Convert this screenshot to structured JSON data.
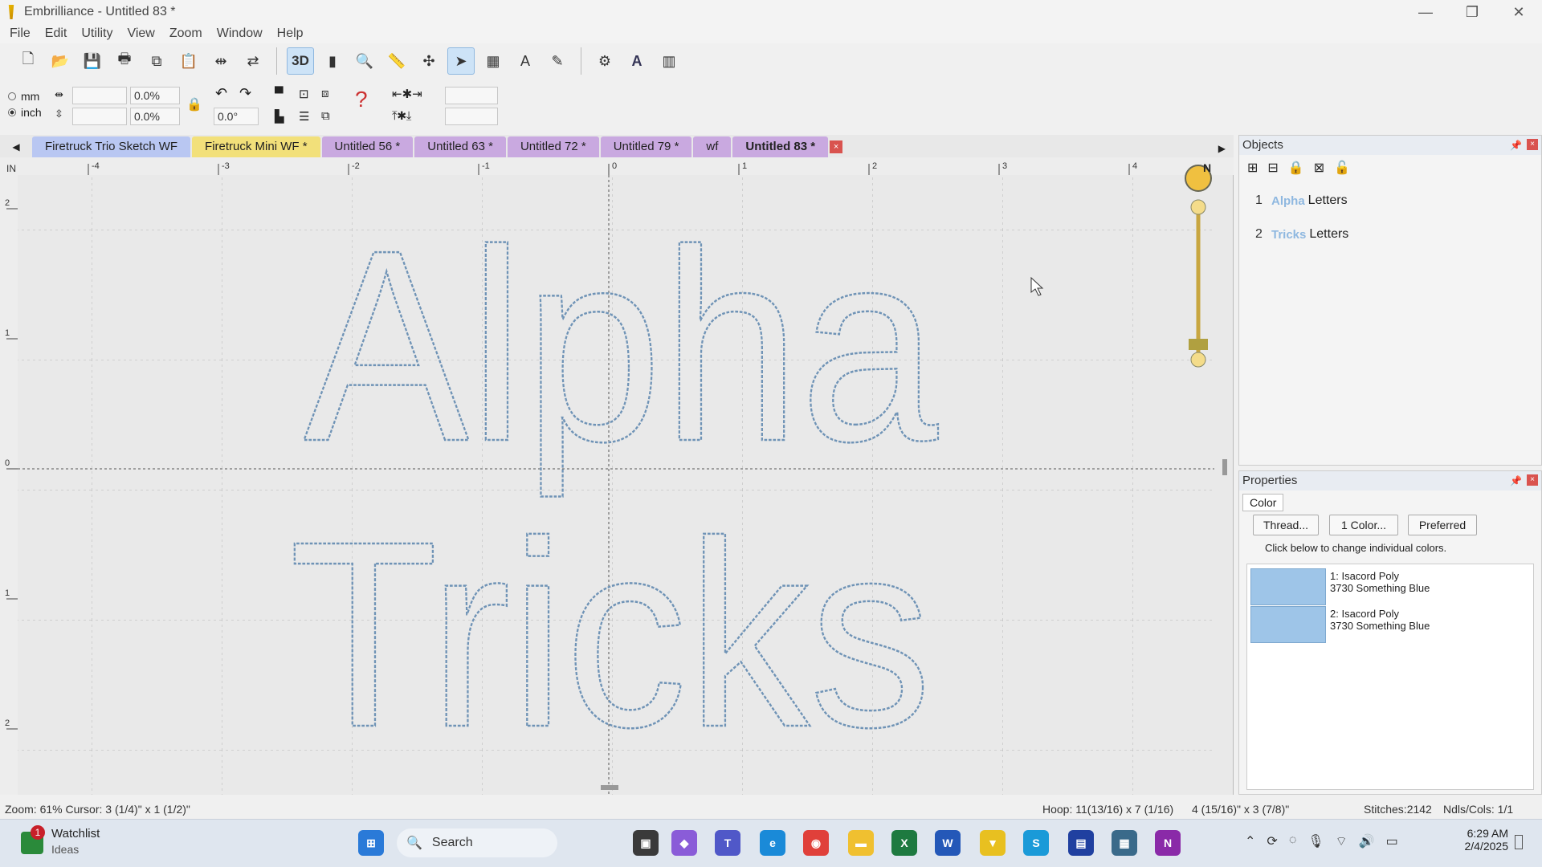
{
  "window": {
    "title": "Embrilliance - Untitled 83 *",
    "minimize": "—",
    "maximize": "❐",
    "close": "✕"
  },
  "menu": [
    "File",
    "Edit",
    "Utility",
    "View",
    "Zoom",
    "Window",
    "Help"
  ],
  "toolbar2": {
    "unit_mm": "mm",
    "unit_inch": "inch",
    "width_value": "",
    "height_value": "",
    "width_pct": "0.0%",
    "height_pct": "0.0%",
    "rotation": "0.0°"
  },
  "tabs": [
    {
      "label": "Firetruck Trio Sketch WF",
      "color": "#b9c7f2"
    },
    {
      "label": "Firetruck Mini WF *",
      "color": "#f2e07a"
    },
    {
      "label": "Untitled 56 *",
      "color": "#c9a9e0"
    },
    {
      "label": "Untitled 63 *",
      "color": "#c9a9e0"
    },
    {
      "label": "Untitled 72 *",
      "color": "#c9a9e0"
    },
    {
      "label": "Untitled 79 *",
      "color": "#c9a9e0"
    },
    {
      "label": "wf",
      "color": "#c9a9e0"
    },
    {
      "label": "Untitled 83 *",
      "color": "#c9a9e0",
      "active": true
    }
  ],
  "ruler": {
    "corner": "IN",
    "top_ticks": [
      "-4",
      "-3",
      "-2",
      "-1",
      "0",
      "1",
      "2",
      "3",
      "4"
    ],
    "left_ticks": [
      "2",
      "1",
      "0",
      "1",
      "2"
    ]
  },
  "canvas": {
    "line1": "Alpha",
    "line2": "Tricks",
    "compass": "N"
  },
  "objects": {
    "title": "Objects",
    "items": [
      {
        "num": "1",
        "thumb": "Alpha",
        "label": "Letters"
      },
      {
        "num": "2",
        "thumb": "Tricks",
        "label": "Letters"
      }
    ]
  },
  "properties": {
    "title": "Properties",
    "tab": "Color",
    "buttons": [
      "Thread...",
      "1 Color...",
      "Preferred"
    ],
    "hint": "Click below to change individual colors.",
    "colors": [
      {
        "line1": "1: Isacord Poly",
        "line2": "3730 Something Blue",
        "hex": "#9ec5e8"
      },
      {
        "line1": "2: Isacord Poly",
        "line2": "3730 Something Blue",
        "hex": "#9ec5e8"
      }
    ]
  },
  "status": {
    "left": "Zoom: 61%  Cursor: 3 (1/4)\" x 1 (1/2)\"",
    "hoop": "Hoop: 11(13/16) x 7 (1/16)",
    "size": "4 (15/16)\" x 3 (7/8)\"",
    "stitches": "Stitches:2142",
    "ndls": "Ndls/Cols: 1/1"
  },
  "taskbar": {
    "watch_title": "Watchlist",
    "watch_sub": "Ideas",
    "badge": "1",
    "search": "Search",
    "time": "6:29 AM",
    "date": "2/4/2025"
  }
}
